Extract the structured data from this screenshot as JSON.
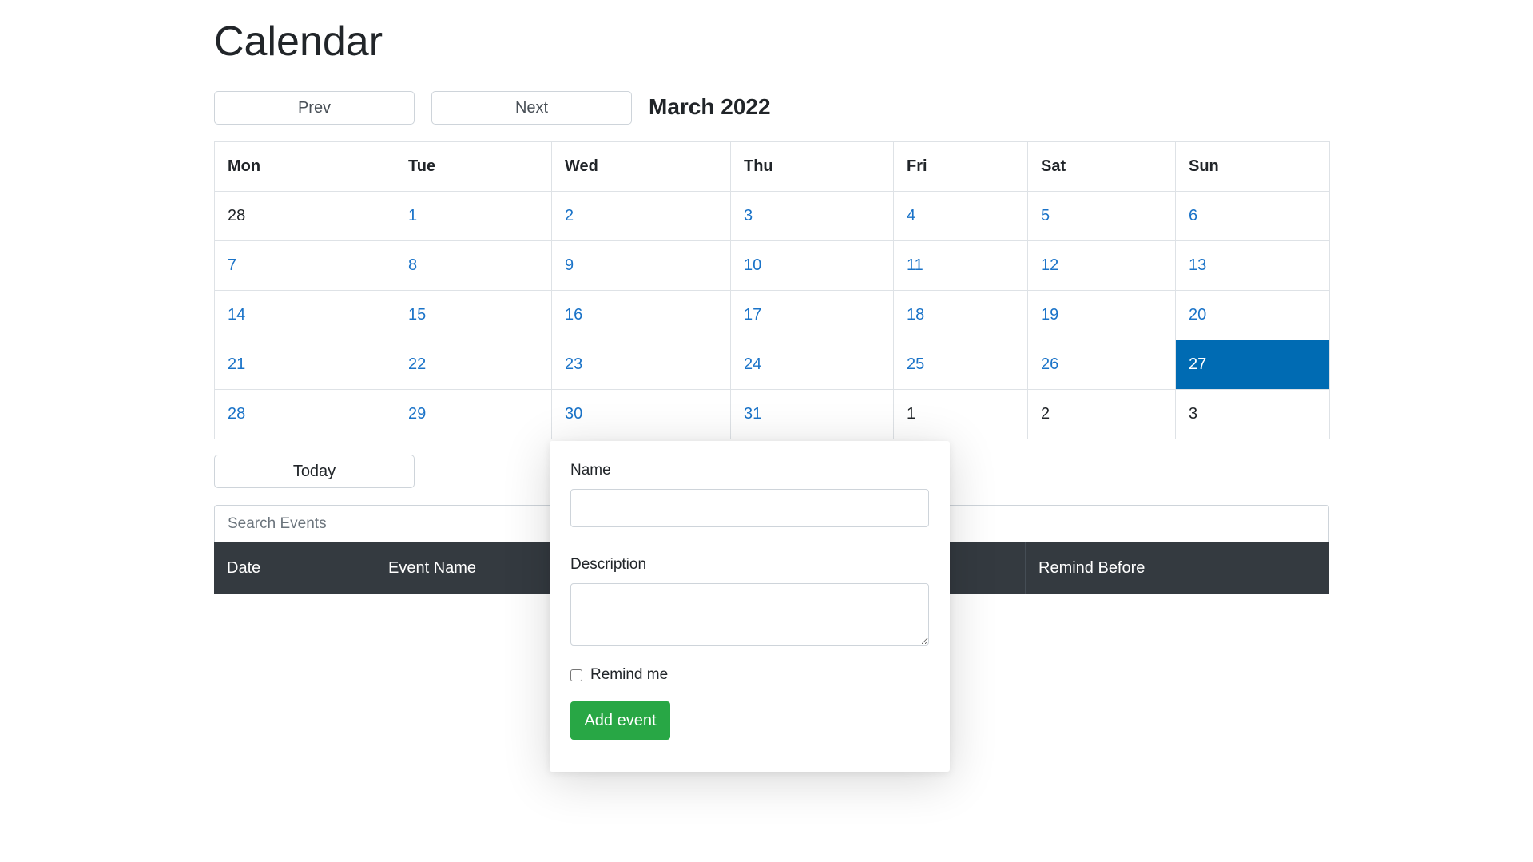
{
  "page": {
    "title": "Calendar"
  },
  "navigation": {
    "prev_label": "Prev",
    "next_label": "Next",
    "month_label": "March 2022"
  },
  "calendar": {
    "weekdays": [
      "Mon",
      "Tue",
      "Wed",
      "Thu",
      "Fri",
      "Sat",
      "Sun"
    ],
    "weeks": [
      [
        {
          "day": "28",
          "in_month": false
        },
        {
          "day": "1",
          "in_month": true
        },
        {
          "day": "2",
          "in_month": true
        },
        {
          "day": "3",
          "in_month": true
        },
        {
          "day": "4",
          "in_month": true
        },
        {
          "day": "5",
          "in_month": true
        },
        {
          "day": "6",
          "in_month": true
        }
      ],
      [
        {
          "day": "7",
          "in_month": true
        },
        {
          "day": "8",
          "in_month": true
        },
        {
          "day": "9",
          "in_month": true
        },
        {
          "day": "10",
          "in_month": true
        },
        {
          "day": "11",
          "in_month": true
        },
        {
          "day": "12",
          "in_month": true
        },
        {
          "day": "13",
          "in_month": true
        }
      ],
      [
        {
          "day": "14",
          "in_month": true
        },
        {
          "day": "15",
          "in_month": true
        },
        {
          "day": "16",
          "in_month": true
        },
        {
          "day": "17",
          "in_month": true
        },
        {
          "day": "18",
          "in_month": true
        },
        {
          "day": "19",
          "in_month": true
        },
        {
          "day": "20",
          "in_month": true
        }
      ],
      [
        {
          "day": "21",
          "in_month": true
        },
        {
          "day": "22",
          "in_month": true
        },
        {
          "day": "23",
          "in_month": true
        },
        {
          "day": "24",
          "in_month": true
        },
        {
          "day": "25",
          "in_month": true
        },
        {
          "day": "26",
          "in_month": true
        },
        {
          "day": "27",
          "in_month": true,
          "selected": true
        }
      ],
      [
        {
          "day": "28",
          "in_month": true
        },
        {
          "day": "29",
          "in_month": true
        },
        {
          "day": "30",
          "in_month": true
        },
        {
          "day": "31",
          "in_month": true
        },
        {
          "day": "1",
          "in_month": false
        },
        {
          "day": "2",
          "in_month": false
        },
        {
          "day": "3",
          "in_month": false
        }
      ]
    ]
  },
  "today_label": "Today",
  "search": {
    "placeholder": "Search Events"
  },
  "events_table": {
    "headers": [
      "Date",
      "Event Name",
      "",
      "Remind Before"
    ]
  },
  "event_form": {
    "name_label": "Name",
    "description_label": "Description",
    "remind_label": "Remind me",
    "submit_label": "Add event"
  },
  "colors": {
    "link_blue": "#1a73c8",
    "selected_day_bg": "#006bb3",
    "table_header_bg": "#343a40",
    "add_button_green": "#28a745"
  }
}
